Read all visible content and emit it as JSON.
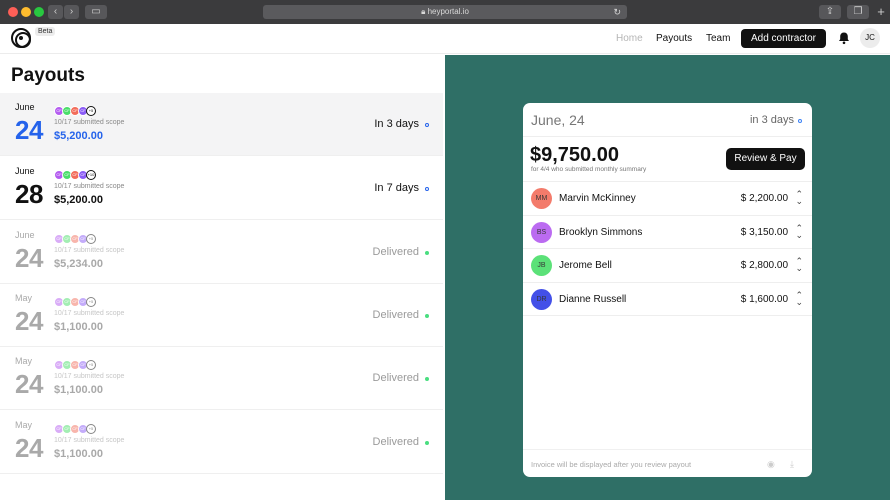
{
  "browser": {
    "url": "heyportal.io",
    "traffic_colors": [
      "#fe5f57",
      "#febc2e",
      "#28c840"
    ]
  },
  "nav": {
    "beta": "Beta",
    "home": "Home",
    "payouts": "Payouts",
    "team": "Team",
    "add_contractor": "Add contractor",
    "user_initials": "JC"
  },
  "page": {
    "title": "Payouts"
  },
  "payouts": [
    {
      "month": "June",
      "day": "24",
      "scope": "10/17 submitted scope",
      "amount": "$5,200.00",
      "status": "In 3 days",
      "avatar_extra": "+5"
    },
    {
      "month": "June",
      "day": "28",
      "scope": "10/17 submitted scope",
      "amount": "$5,200.00",
      "status": "In 7 days",
      "avatar_extra": "+10"
    },
    {
      "month": "June",
      "day": "24",
      "scope": "10/17 submitted scope",
      "amount": "$5,234.00",
      "status": "Delivered",
      "avatar_extra": "+5"
    },
    {
      "month": "May",
      "day": "24",
      "scope": "10/17 submitted scope",
      "amount": "$1,100.00",
      "status": "Delivered",
      "avatar_extra": "+5"
    },
    {
      "month": "May",
      "day": "24",
      "scope": "10/17 submitted scope",
      "amount": "$1,100.00",
      "status": "Delivered",
      "avatar_extra": "+5"
    },
    {
      "month": "May",
      "day": "24",
      "scope": "10/17 submitted scope",
      "amount": "$1,100.00",
      "status": "Delivered",
      "avatar_extra": "+5"
    }
  ],
  "avatar_initials": [
    "CF",
    "CF",
    "CF",
    "CF"
  ],
  "detail": {
    "date": "June, 24",
    "due": "in 3 days",
    "total": "$9,750.00",
    "subtitle": "for 4/4 who submitted monthly summary",
    "review_button": "Review & Pay",
    "people": [
      {
        "initials": "MM",
        "name": "Marvin McKinney",
        "amount": "$ 2,200.00",
        "color": "#f26d5b"
      },
      {
        "initials": "BS",
        "name": "Brooklyn Simmons",
        "amount": "$ 3,150.00",
        "color": "#b45cf0"
      },
      {
        "initials": "JB",
        "name": "Jerome Bell",
        "amount": "$ 2,800.00",
        "color": "#4ade6a"
      },
      {
        "initials": "DR",
        "name": "Dianne Russell",
        "amount": "$ 1,600.00",
        "color": "#2f3ee6"
      }
    ],
    "footer_note": "Invoice will be displayed after you review payout"
  },
  "colors": {
    "accent_blue": "#2563eb",
    "panel_green": "#2f6f66",
    "delivered_dot": "#4ade80"
  }
}
